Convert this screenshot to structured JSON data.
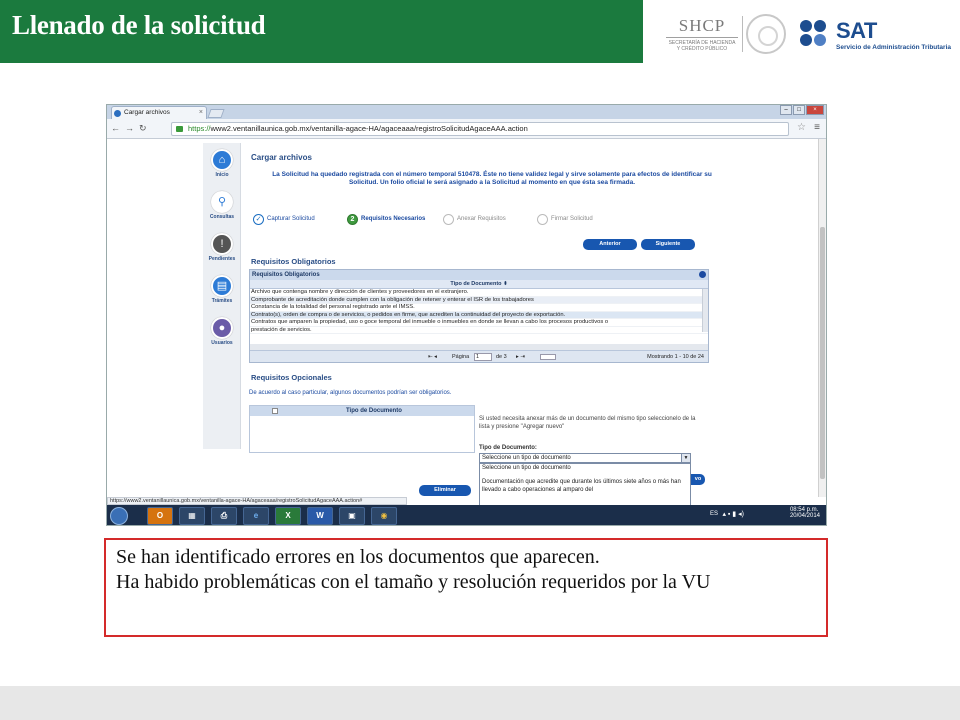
{
  "slide": {
    "title": "Llenado de la solicitud",
    "header_color": "#1b7a3e",
    "logos": {
      "shcp": "SHCP",
      "shcp_sub_1": "SECRETARÍA DE HACIENDA",
      "shcp_sub_2": "Y CRÉDITO PÚBLICO",
      "sat": "SAT",
      "sat_sub": "Servicio de Administración Tributaria"
    }
  },
  "browser": {
    "tab_label": "Cargar archivos",
    "tab_close": "×",
    "url_https": "https://",
    "url_rest": "www2.ventanillaunica.gob.mx/ventanilla-agace-HA/agaceaaa/registroSolicitudAgaceAAA.action",
    "status_url": "https://www2.ventanillaunica.gob.mx/ventanilla-agace-HA/agaceaaa/registroSolicitudAgaceAAA.action#"
  },
  "sidebar": {
    "items": [
      {
        "label": "Inicio",
        "icon": "home-icon",
        "color": "#2d7bd6",
        "glyph": "⌂"
      },
      {
        "label": "Consultas",
        "icon": "search-icon",
        "color": "#ffffff",
        "glyph": "⚲"
      },
      {
        "label": "Pendientes",
        "icon": "alert-icon",
        "color": "#555555",
        "glyph": "!"
      },
      {
        "label": "Trámites",
        "icon": "document-icon",
        "color": "#2d7bd6",
        "glyph": "▤"
      },
      {
        "label": "Usuarios",
        "icon": "users-icon",
        "color": "#6b5ca8",
        "glyph": "●"
      }
    ]
  },
  "page": {
    "heading": "Cargar archivos",
    "notice": "La Solicitud ha quedado registrada con el número temporal 510478. Éste no tiene validez legal y sirve solamente para efectos de identificar su Solicitud. Un folio oficial le será asignado a la Solicitud al momento en que ésta sea firmada.",
    "steps": [
      {
        "label": "Capturar Solicitud",
        "state": "done",
        "mark": "✓"
      },
      {
        "label": "Requisitos Necesarios",
        "state": "current",
        "mark": "2"
      },
      {
        "label": "Anexar Requisitos",
        "state": "pending",
        "mark": ""
      },
      {
        "label": "Firmar Solicitud",
        "state": "pending",
        "mark": ""
      }
    ],
    "btn_prev": "Anterior",
    "btn_next": "Siguiente",
    "req_obligatorios_title": "Requisitos Obligatorios",
    "grid": {
      "caption": "Requisitos Obligatorios",
      "column": "Tipo de Documento ⬍",
      "rows": [
        "Archivo que contenga nombre y dirección de clientes y proveedores en el extranjero.",
        "Comprobante de acreditación donde cumplen con la obligación de retener y enterar el ISR de los trabajadores",
        "Constancia de la totalidad del personal registrado ante el IMSS.",
        "Contrato(s), orden de compra o de servicios, o pedidos en firme, que acrediten la continuidad del proyecto de exportación.",
        "Contratos que amparen la propiedad, uso o goce temporal del inmueble o inmuebles en donde se llevan a cabo los procesos productivos o",
        "prestación de servicios."
      ],
      "pager_prefix": "Página",
      "pager_value": "1",
      "pager_of": "de 3",
      "showing": "Mostrando 1 - 10 de 24"
    },
    "req_opcionales_title": "Requisitos Opcionales",
    "opcionales_help": "De acuerdo al caso particular, algunos documentos podrían ser obligatorios.",
    "opt_grid_column": "Tipo de Documento",
    "right_help": "Si usted necesita anexar más de un documento del mismo tipo seleccionelo de la lista y presione \"Agregar nuevo\"",
    "tipo_label": "Tipo de Documento:",
    "select_value": "Seleccione un tipo de documento",
    "dropdown_options": [
      "Seleccione un tipo de documento",
      "Documentación que acredite que durante los últimos siete años o más han llevado a cabo operaciones al amparo del"
    ],
    "btn_eliminar": "Eliminar",
    "btn_agregar_fragment": "vo"
  },
  "taskbar": {
    "lang": "ES",
    "time": "08:54 p.m.",
    "date": "20/04/2014",
    "apps": [
      "O",
      "▦",
      "⎙",
      "e",
      "X",
      "W",
      "▣",
      "◉"
    ]
  },
  "caption": {
    "line1": "Se han identificado errores en los documentos que aparecen.",
    "line2": "Ha habido problemáticas con el tamaño y resolución requeridos por la VU",
    "border_color": "#d42a2a"
  }
}
